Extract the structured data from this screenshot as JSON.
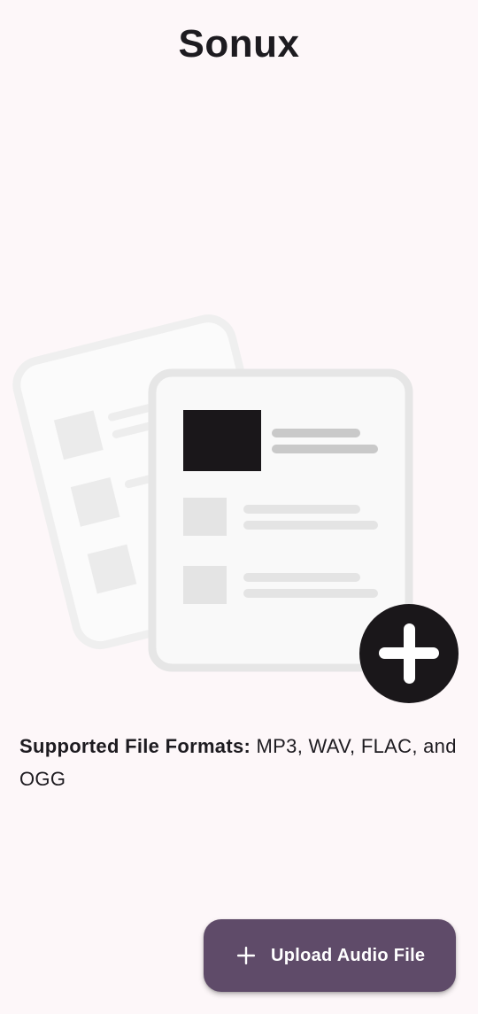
{
  "app": {
    "title": "Sonux"
  },
  "empty_state": {
    "formats_lead": "Supported File Formats:",
    "formats_list": " MP3, WAV, FLAC, and OGG"
  },
  "fab": {
    "label": "Upload Audio File",
    "icon": "plus-icon"
  },
  "illustration": {
    "icon": "add-file-icon",
    "colors": {
      "back_card_stroke": "#EFEFEF",
      "front_card_stroke": "#E6E6E6",
      "placeholder": "#E4E4E4",
      "accent_block": "#1A171A",
      "add_badge": "#1A171A"
    }
  },
  "theme": {
    "background": "#FDF7F9",
    "fab_background": "#5F4B69",
    "text": "#1D1B20"
  }
}
